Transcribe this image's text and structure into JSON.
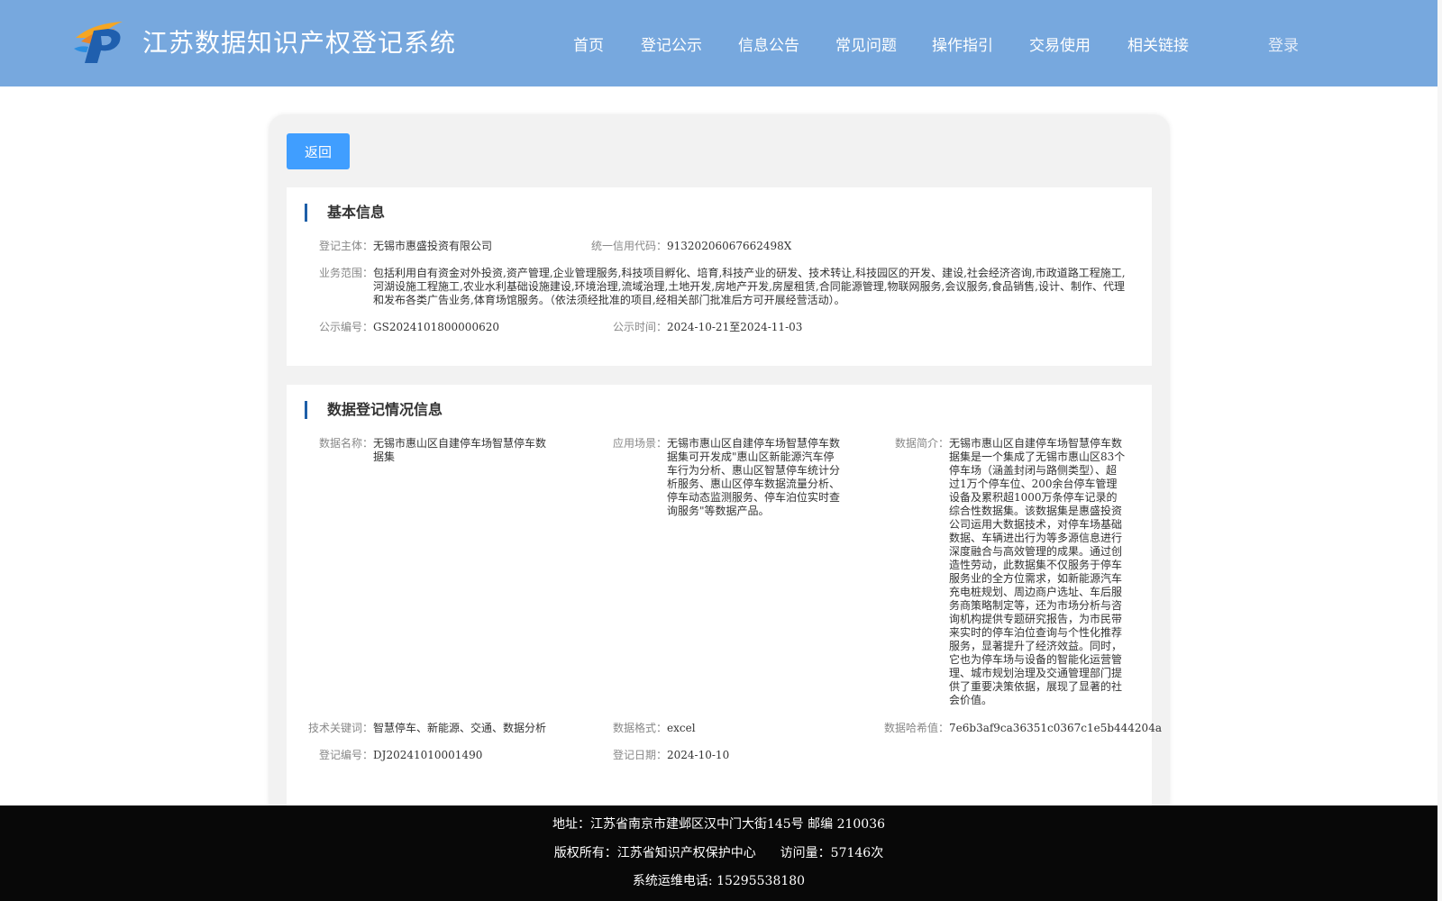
{
  "site": {
    "title": "江苏数据知识产权登记系统"
  },
  "nav": {
    "items": [
      "首页",
      "登记公示",
      "信息公告",
      "常见问题",
      "操作指引",
      "交易使用",
      "相关链接"
    ],
    "login": "登录"
  },
  "back_button": "返回",
  "basic_info": {
    "title": "基本信息",
    "subject_label": "登记主体：",
    "subject_value": "无锡市惠盛投资有限公司",
    "credit_label": "统一信用代码：",
    "credit_value": "91320206067662498X",
    "scope_label": "业务范围：",
    "scope_value": "包括利用自有资金对外投资,资产管理,企业管理服务,科技项目孵化、培育,科技产业的研发、技术转让,科技园区的开发、建设,社会经济咨询,市政道路工程施工,河湖设施工程施工,农业水利基础设施建设,环境治理,流域治理,土地开发,房地产开发,房屋租赁,合同能源管理,物联网服务,会议服务,食品销售,设计、制作、代理和发布各类广告业务,体育场馆服务。（依法须经批准的项目,经相关部门批准后方可开展经营活动）。",
    "notice_no_label": "公示编号：",
    "notice_no_value": "GS2024101800000620",
    "notice_time_label": "公示时间：",
    "notice_time_value": "2024-10-21至2024-11-03"
  },
  "data_info": {
    "title": "数据登记情况信息",
    "name_label": "数据名称：",
    "name_value": "无锡市惠山区自建停车场智慧停车数据集",
    "scene_label": "应用场景：",
    "scene_value": "无锡市惠山区自建停车场智慧停车数据集可开发成\"惠山区新能源汽车停车行为分析、惠山区智慧停车统计分析服务、惠山区停车数据流量分析、停车动态监测服务、停车泊位实时查询服务\"等数据产品。",
    "intro_label": "数据简介：",
    "intro_value": "无锡市惠山区自建停车场智慧停车数据集是一个集成了无锡市惠山区83个停车场（涵盖封闭与路侧类型）、超过1万个停车位、200余台停车管理设备及累积超1000万条停车记录的综合性数据集。该数据集是惠盛投资公司运用大数据技术，对停车场基础数据、车辆进出行为等多源信息进行深度融合与高效管理的成果。通过创造性劳动，此数据集不仅服务于停车服务业的全方位需求，如新能源汽车充电桩规划、周边商户选址、车后服务商策略制定等，还为市场分析与咨询机构提供专题研究报告，为市民带来实时的停车泊位查询与个性化推荐服务，显著提升了经济效益。同时，它也为停车场与设备的智能化运营管理、城市规划治理及交通管理部门提供了重要决策依据，展现了显著的社会价值。",
    "keywords_label": "技术关键词：",
    "keywords_value": "智慧停车、新能源、交通、数据分析",
    "format_label": "数据格式：",
    "format_value": "excel",
    "hash_label": "数据哈希值：",
    "hash_value": "7e6b3af9ca36351c0367c1e5b444204a",
    "reg_no_label": "登记编号：",
    "reg_no_value": "DJ20241010001490",
    "reg_date_label": "登记日期：",
    "reg_date_value": "2024-10-10"
  },
  "footer": {
    "address": "地址：江苏省南京市建邺区汉中门大街145号 邮编 210036",
    "copyright": "版权所有：江苏省知识产权保护中心",
    "visits": "访问量：57146次",
    "phone": "系统运维电话: 15295538180"
  },
  "colors": {
    "header": "#77a8de",
    "button": "#409eff",
    "accent_bar": "#1e5fa8",
    "footer": "#080808"
  }
}
